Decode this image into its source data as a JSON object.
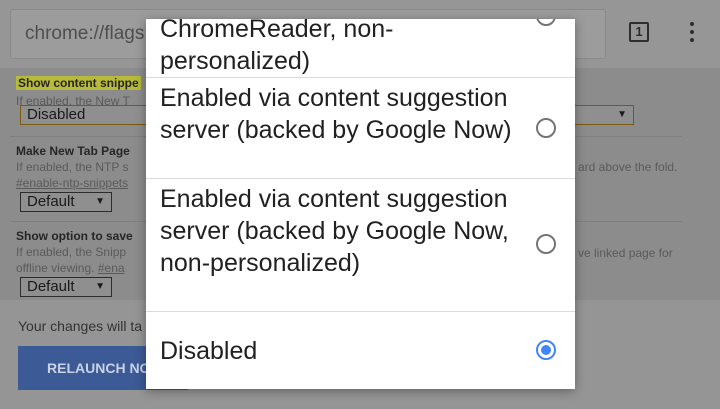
{
  "toolbar": {
    "url": "chrome://flags",
    "tab_count": "1",
    "menu_icon": "more-vert-icon"
  },
  "flags": [
    {
      "title": "Show content snippe",
      "desc": "If enabled, the New T",
      "value": "Disabled"
    },
    {
      "title": "Make New Tab Page",
      "desc": "If enabled, the NTP s",
      "desc_right": "ard above the fold.",
      "link": "#enable-ntp-snippets",
      "value": "Default"
    },
    {
      "title": "Show option to save",
      "desc": "If enabled, the Snipp",
      "desc_right": "ve linked page for",
      "desc2": "offline viewing.",
      "link": "#ena",
      "value": "Default"
    }
  ],
  "bottom": {
    "message": "Your changes will ta",
    "relaunch_label": "RELAUNCH NO"
  },
  "dialog": {
    "options": [
      {
        "label": "ChromeReader, non-personalized)",
        "selected": false
      },
      {
        "label": "Enabled via content suggestion server (backed by Google Now)",
        "selected": false
      },
      {
        "label": "Enabled via content suggestion server (backed by Google Now, non-personalized)",
        "selected": false
      },
      {
        "label": "Disabled",
        "selected": true
      }
    ]
  },
  "colors": {
    "accent": "#4285f4",
    "highlight": "#b8ba3a"
  }
}
